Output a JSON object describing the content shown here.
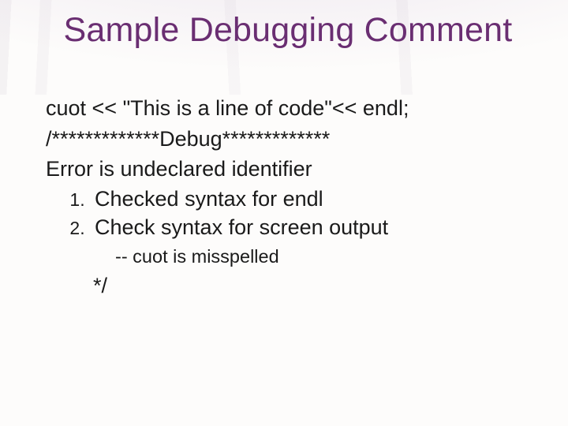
{
  "title": "Sample Debugging Comment",
  "body": {
    "line1": "cuot << \"This is a line of code\"<< endl;",
    "line2": "/*************Debug*************",
    "line3": "Error is undeclared identifier",
    "list": [
      "Checked syntax for endl",
      "Check syntax for screen output"
    ],
    "sub": "-- cuot is misspelled",
    "closer": "*/"
  }
}
